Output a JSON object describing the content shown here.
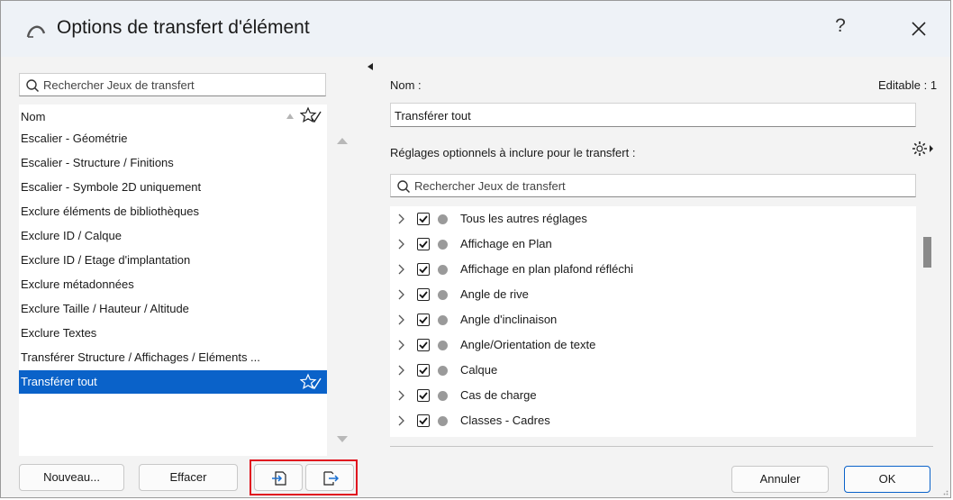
{
  "window": {
    "title": "Options de transfert d'élément",
    "help_label": "?"
  },
  "left": {
    "search_placeholder": "Rechercher Jeux de transfert",
    "column_header": "Nom",
    "items": [
      "Escalier - Géométrie",
      "Escalier - Structure / Finitions",
      "Escalier - Symbole 2D uniquement",
      "Exclure éléments de bibliothèques",
      "Exclure ID / Calque",
      "Exclure ID / Etage d'implantation",
      "Exclure métadonnées",
      "Exclure Taille / Hauteur / Altitude",
      "Exclure Textes",
      "Transférer Structure / Affichages / Eléments ...",
      "Transférer tout"
    ],
    "selected_index": 10,
    "buttons": {
      "new_label": "Nouveau...",
      "delete_label": "Effacer"
    }
  },
  "right": {
    "name_label": "Nom :",
    "editable_label": "Editable : 1",
    "name_value": "Transférer tout",
    "optional_label": "Réglages optionnels à inclure pour le transfert :",
    "search_placeholder": "Rechercher Jeux de transfert",
    "tree_items": [
      {
        "label": "Tous les autres réglages",
        "checked": true
      },
      {
        "label": "Affichage en Plan",
        "checked": true
      },
      {
        "label": "Affichage en plan plafond réfléchi",
        "checked": true
      },
      {
        "label": "Angle de rive",
        "checked": true
      },
      {
        "label": "Angle d'inclinaison",
        "checked": true
      },
      {
        "label": "Angle/Orientation de texte",
        "checked": true
      },
      {
        "label": "Calque",
        "checked": true
      },
      {
        "label": "Cas de charge",
        "checked": true
      },
      {
        "label": "Classes - Cadres",
        "checked": true
      }
    ]
  },
  "footer": {
    "cancel_label": "Annuler",
    "ok_label": "OK"
  },
  "colors": {
    "selection": "#0a62c9",
    "highlight_box": "#e0141f",
    "titlebar": "#eef2f7"
  }
}
